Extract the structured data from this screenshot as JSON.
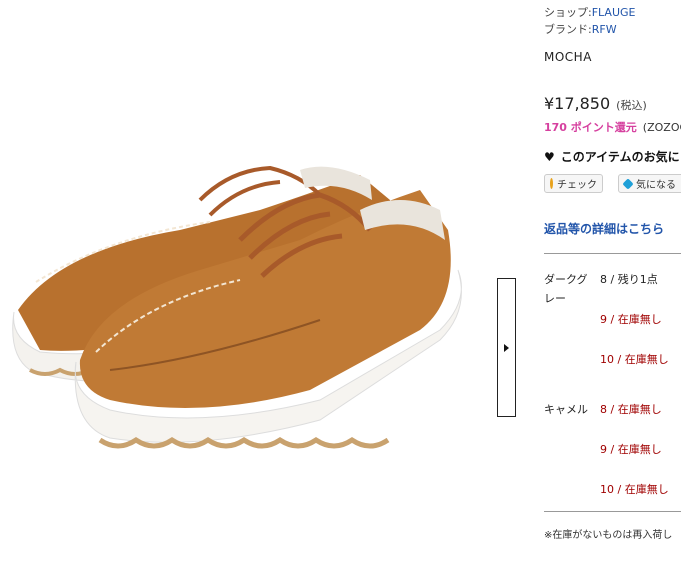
{
  "shop": {
    "label": "ショップ:",
    "value": "FLAUGE"
  },
  "brand": {
    "label": "ブランド:",
    "value": "RFW"
  },
  "product_name": "MOCHA",
  "price": {
    "amount": "¥17,850",
    "tax": "(税込)"
  },
  "points": {
    "text": "170 ポイント還元",
    "extra": "(ZOZOC"
  },
  "favorite": {
    "icon": "heart-icon",
    "label": "このアイテムのお気に"
  },
  "buttons": {
    "check": {
      "icon": "m-circle-icon",
      "label": "チェック"
    },
    "watch": {
      "icon": "blue-diamond-icon",
      "label": "気になる"
    }
  },
  "returns_link": "返品等の詳細はこちら",
  "nav": {
    "next_icon": "right-triangle-icon"
  },
  "colors": [
    {
      "name_line1": "ダークグ",
      "name_line2": "レー",
      "sizes": [
        {
          "size": "8",
          "sep": " / ",
          "status": "残り1点",
          "state": "ok"
        },
        {
          "size": "9",
          "sep": " / ",
          "status": "在庫無し",
          "state": "out"
        },
        {
          "size": "10",
          "sep": " / ",
          "status": "在庫無し",
          "state": "out"
        }
      ]
    },
    {
      "name_line1": "キャメル",
      "sizes": [
        {
          "size": "8",
          "sep": " / ",
          "status": "在庫無し",
          "state": "out"
        },
        {
          "size": "9",
          "sep": " / ",
          "status": "在庫無し",
          "state": "out"
        },
        {
          "size": "10",
          "sep": " / ",
          "status": "在庫無し",
          "state": "out"
        }
      ]
    }
  ],
  "note": "※在庫がないものは再入荷し",
  "theme": {
    "link": "#2255aa",
    "points": "#d6409f",
    "out_of_stock": "#a00000",
    "leather": "#c07a35"
  }
}
